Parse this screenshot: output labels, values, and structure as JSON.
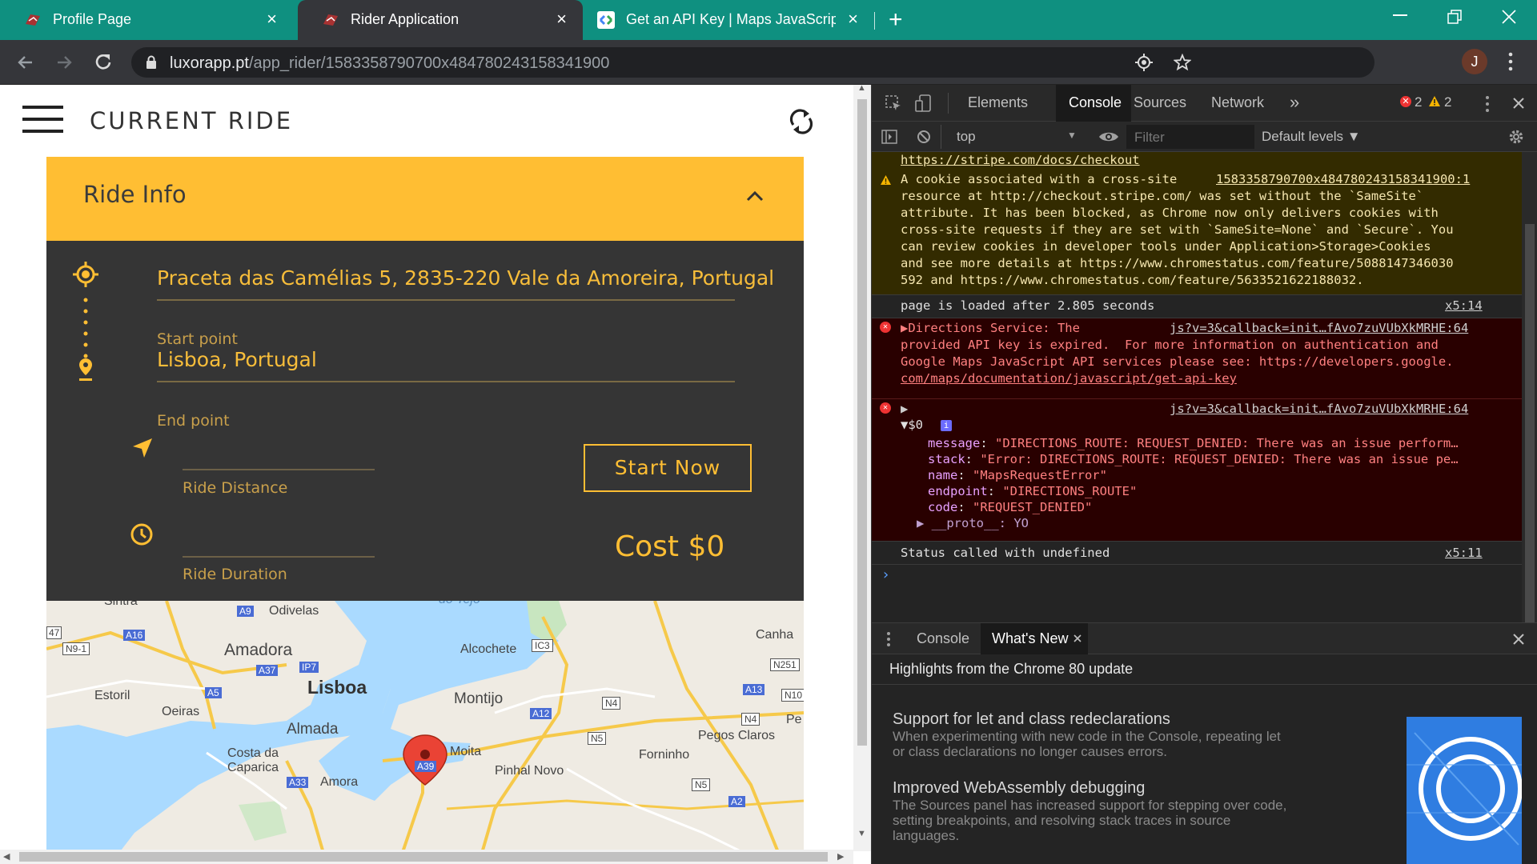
{
  "browser": {
    "tabs": [
      {
        "title": "Profile Page",
        "close": "×"
      },
      {
        "title": "Rider Application",
        "close": "×"
      },
      {
        "title": "Get an API Key  |  Maps JavaScript",
        "close": "×"
      }
    ],
    "new_tab": "+",
    "url_host": "luxorapp.pt",
    "url_path": "/app_rider/1583358790700x484780243158341900",
    "profile_initial": "J"
  },
  "page": {
    "title": "CURRENT RIDE",
    "card_title": "Ride Info",
    "start_address": "Praceta das Camélias 5, 2835-220 Vale da Amoreira, Portugal",
    "start_label": "Start point",
    "end_address": "Lisboa, Portugal",
    "end_label": "End point",
    "distance_label": "Ride Distance",
    "duration_label": "Ride Duration",
    "start_button": "Start Now",
    "cost": "Cost $0"
  },
  "map": {
    "labels": [
      "Sintra",
      "Odivelas",
      "A9",
      "A16",
      "N9-1",
      "Amadora",
      "A37",
      "IP7",
      "Lisboa",
      "Estoril",
      "A5",
      "Oeiras",
      "Alcochete",
      "IC3",
      "Canha",
      "N251",
      "A13",
      "N10",
      "N4",
      "Montijo",
      "A12",
      "Almada",
      "Costa da Caparica",
      "Moita",
      "A39",
      "N5",
      "Pegos Claros",
      "Forninho",
      "Pinhal Novo",
      "A33",
      "Amora",
      "N5",
      "A2",
      "N4",
      "Pe",
      "47",
      "do Tejo"
    ]
  },
  "devtools": {
    "tabs": [
      "Elements",
      "Console",
      "Sources",
      "Network"
    ],
    "more": "»",
    "error_count": "2",
    "warning_count": "2",
    "context": "top",
    "filter_placeholder": "Filter",
    "levels": "Default levels ▼",
    "log": {
      "line0": "https://stripe.com/docs/checkout",
      "warn_src": "1583358790700x484780243158341900:1",
      "warn_lines": [
        "A cookie associated with a cross-site",
        "resource at http://checkout.stripe.com/ was set without the `SameSite`",
        "attribute. It has been blocked, as Chrome now only delivers cookies with",
        "cross-site requests if they are set with `SameSite=None` and `Secure`. You",
        "can review cookies in developer tools under Application>Storage>Cookies",
        "and see more details at https://www.chromestatus.com/feature/5088147346030",
        "592 and https://www.chromestatus.com/feature/5633521622188032."
      ],
      "loaded": "page is loaded after 2.805 seconds",
      "loaded_src": "x5:14",
      "err1_src": "js?v=3&callback=init…fAvo7zuVUbXkMRHE:64",
      "err1_lines": [
        "▶Directions Service: The",
        "provided API key is expired.  For more information on authentication and",
        "Google Maps JavaScript API services please see: https://developers.google.",
        "com/maps/documentation/javascript/get-api-key"
      ],
      "err2_src": "js?v=3&callback=init…fAvo7zuVUbXkMRHE:64",
      "err2_arrow": "▶",
      "obj_name": "▼$0",
      "obj_info": "i",
      "fields": [
        {
          "k": "message",
          "v": "\"DIRECTIONS_ROUTE: REQUEST_DENIED: There was an issue perform…"
        },
        {
          "k": "stack",
          "v": "\"Error: DIRECTIONS_ROUTE: REQUEST_DENIED: There was an issue pe…"
        },
        {
          "k": "name",
          "v": "\"MapsRequestError\""
        },
        {
          "k": "endpoint",
          "v": "\"DIRECTIONS_ROUTE\""
        },
        {
          "k": "code",
          "v": "\"REQUEST_DENIED\""
        }
      ],
      "proto": "▶ __proto__: YO",
      "status": "Status called with undefined",
      "status_src": "x5:11",
      "prompt": "›"
    },
    "drawer": {
      "tab_console": "Console",
      "tab_whatsnew": "What's New",
      "heading": "Highlights from the Chrome 80 update",
      "items": [
        {
          "title": "Support for let and class redeclarations",
          "body1": "When experimenting with new code in the Console, repeating let",
          "body2": "or class declarations no longer causes errors."
        },
        {
          "title": "Improved WebAssembly debugging",
          "body1": "The Sources panel has increased support for stepping over code,",
          "body2": "setting breakpoints, and resolving stack traces in source",
          "body3": "languages."
        }
      ]
    }
  },
  "colors": {
    "tabbar": "#0f9080",
    "accent": "#ffbe33",
    "panel": "#353535",
    "gold_text": "#f7bd3a"
  }
}
